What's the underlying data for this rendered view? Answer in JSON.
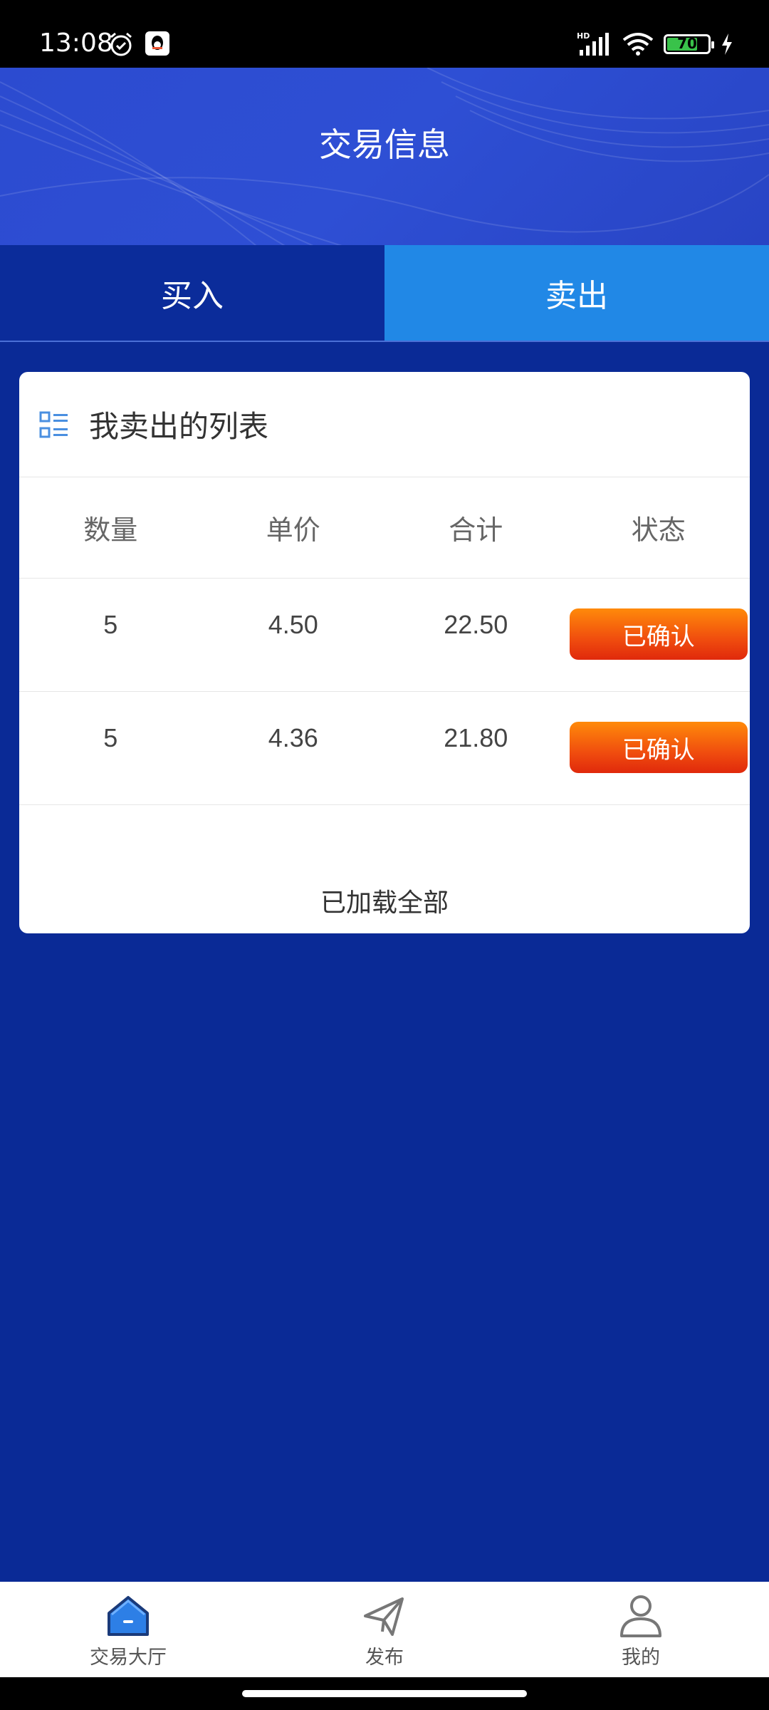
{
  "status_bar": {
    "time": "13:08",
    "battery_level": "70",
    "icons": [
      "alarm-icon",
      "qq-icon",
      "signal-hd-icon",
      "wifi-icon",
      "battery-icon",
      "charging-icon"
    ]
  },
  "header": {
    "title": "交易信息"
  },
  "tabs": [
    {
      "label": "买入",
      "active": false
    },
    {
      "label": "卖出",
      "active": true
    }
  ],
  "card": {
    "title": "我卖出的列表",
    "icon": "list-icon",
    "columns": [
      "数量",
      "单价",
      "合计",
      "状态"
    ],
    "rows": [
      {
        "quantity": "5",
        "price": "4.50",
        "total": "22.50",
        "status": "已确认"
      },
      {
        "quantity": "5",
        "price": "4.36",
        "total": "21.80",
        "status": "已确认"
      }
    ],
    "footer": "已加载全部"
  },
  "bottom_nav": [
    {
      "label": "交易大厅",
      "icon": "home-icon",
      "active": true
    },
    {
      "label": "发布",
      "icon": "paper-plane-icon",
      "active": false
    },
    {
      "label": "我的",
      "icon": "user-icon",
      "active": false
    }
  ],
  "colors": {
    "page_bg": "#0a2a96",
    "tab_active": "#2188e6",
    "status_button": "#f04d0e"
  }
}
